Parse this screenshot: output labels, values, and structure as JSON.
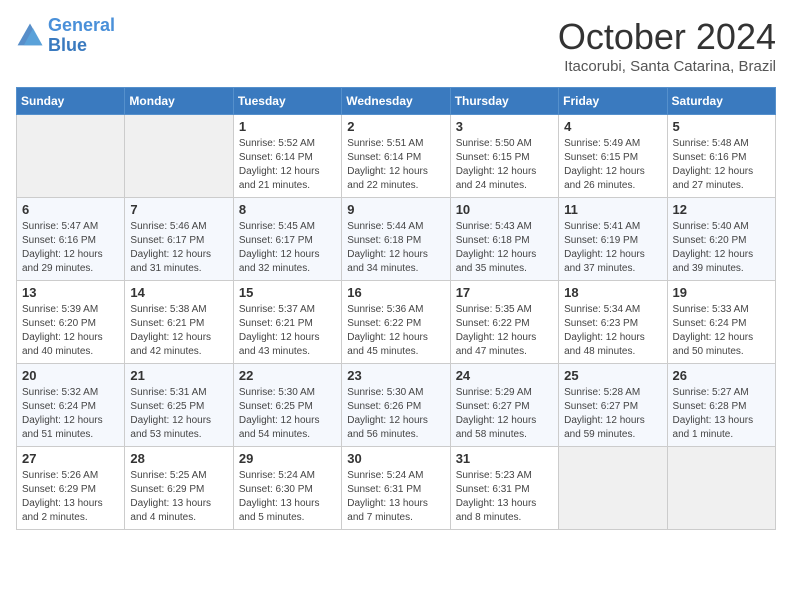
{
  "logo": {
    "line1": "General",
    "line2": "Blue"
  },
  "title": "October 2024",
  "location": "Itacorubi, Santa Catarina, Brazil",
  "weekdays": [
    "Sunday",
    "Monday",
    "Tuesday",
    "Wednesday",
    "Thursday",
    "Friday",
    "Saturday"
  ],
  "weeks": [
    [
      {
        "day": "",
        "sunrise": "",
        "sunset": "",
        "daylight": ""
      },
      {
        "day": "",
        "sunrise": "",
        "sunset": "",
        "daylight": ""
      },
      {
        "day": "1",
        "sunrise": "Sunrise: 5:52 AM",
        "sunset": "Sunset: 6:14 PM",
        "daylight": "Daylight: 12 hours and 21 minutes."
      },
      {
        "day": "2",
        "sunrise": "Sunrise: 5:51 AM",
        "sunset": "Sunset: 6:14 PM",
        "daylight": "Daylight: 12 hours and 22 minutes."
      },
      {
        "day": "3",
        "sunrise": "Sunrise: 5:50 AM",
        "sunset": "Sunset: 6:15 PM",
        "daylight": "Daylight: 12 hours and 24 minutes."
      },
      {
        "day": "4",
        "sunrise": "Sunrise: 5:49 AM",
        "sunset": "Sunset: 6:15 PM",
        "daylight": "Daylight: 12 hours and 26 minutes."
      },
      {
        "day": "5",
        "sunrise": "Sunrise: 5:48 AM",
        "sunset": "Sunset: 6:16 PM",
        "daylight": "Daylight: 12 hours and 27 minutes."
      }
    ],
    [
      {
        "day": "6",
        "sunrise": "Sunrise: 5:47 AM",
        "sunset": "Sunset: 6:16 PM",
        "daylight": "Daylight: 12 hours and 29 minutes."
      },
      {
        "day": "7",
        "sunrise": "Sunrise: 5:46 AM",
        "sunset": "Sunset: 6:17 PM",
        "daylight": "Daylight: 12 hours and 31 minutes."
      },
      {
        "day": "8",
        "sunrise": "Sunrise: 5:45 AM",
        "sunset": "Sunset: 6:17 PM",
        "daylight": "Daylight: 12 hours and 32 minutes."
      },
      {
        "day": "9",
        "sunrise": "Sunrise: 5:44 AM",
        "sunset": "Sunset: 6:18 PM",
        "daylight": "Daylight: 12 hours and 34 minutes."
      },
      {
        "day": "10",
        "sunrise": "Sunrise: 5:43 AM",
        "sunset": "Sunset: 6:18 PM",
        "daylight": "Daylight: 12 hours and 35 minutes."
      },
      {
        "day": "11",
        "sunrise": "Sunrise: 5:41 AM",
        "sunset": "Sunset: 6:19 PM",
        "daylight": "Daylight: 12 hours and 37 minutes."
      },
      {
        "day": "12",
        "sunrise": "Sunrise: 5:40 AM",
        "sunset": "Sunset: 6:20 PM",
        "daylight": "Daylight: 12 hours and 39 minutes."
      }
    ],
    [
      {
        "day": "13",
        "sunrise": "Sunrise: 5:39 AM",
        "sunset": "Sunset: 6:20 PM",
        "daylight": "Daylight: 12 hours and 40 minutes."
      },
      {
        "day": "14",
        "sunrise": "Sunrise: 5:38 AM",
        "sunset": "Sunset: 6:21 PM",
        "daylight": "Daylight: 12 hours and 42 minutes."
      },
      {
        "day": "15",
        "sunrise": "Sunrise: 5:37 AM",
        "sunset": "Sunset: 6:21 PM",
        "daylight": "Daylight: 12 hours and 43 minutes."
      },
      {
        "day": "16",
        "sunrise": "Sunrise: 5:36 AM",
        "sunset": "Sunset: 6:22 PM",
        "daylight": "Daylight: 12 hours and 45 minutes."
      },
      {
        "day": "17",
        "sunrise": "Sunrise: 5:35 AM",
        "sunset": "Sunset: 6:22 PM",
        "daylight": "Daylight: 12 hours and 47 minutes."
      },
      {
        "day": "18",
        "sunrise": "Sunrise: 5:34 AM",
        "sunset": "Sunset: 6:23 PM",
        "daylight": "Daylight: 12 hours and 48 minutes."
      },
      {
        "day": "19",
        "sunrise": "Sunrise: 5:33 AM",
        "sunset": "Sunset: 6:24 PM",
        "daylight": "Daylight: 12 hours and 50 minutes."
      }
    ],
    [
      {
        "day": "20",
        "sunrise": "Sunrise: 5:32 AM",
        "sunset": "Sunset: 6:24 PM",
        "daylight": "Daylight: 12 hours and 51 minutes."
      },
      {
        "day": "21",
        "sunrise": "Sunrise: 5:31 AM",
        "sunset": "Sunset: 6:25 PM",
        "daylight": "Daylight: 12 hours and 53 minutes."
      },
      {
        "day": "22",
        "sunrise": "Sunrise: 5:30 AM",
        "sunset": "Sunset: 6:25 PM",
        "daylight": "Daylight: 12 hours and 54 minutes."
      },
      {
        "day": "23",
        "sunrise": "Sunrise: 5:30 AM",
        "sunset": "Sunset: 6:26 PM",
        "daylight": "Daylight: 12 hours and 56 minutes."
      },
      {
        "day": "24",
        "sunrise": "Sunrise: 5:29 AM",
        "sunset": "Sunset: 6:27 PM",
        "daylight": "Daylight: 12 hours and 58 minutes."
      },
      {
        "day": "25",
        "sunrise": "Sunrise: 5:28 AM",
        "sunset": "Sunset: 6:27 PM",
        "daylight": "Daylight: 12 hours and 59 minutes."
      },
      {
        "day": "26",
        "sunrise": "Sunrise: 5:27 AM",
        "sunset": "Sunset: 6:28 PM",
        "daylight": "Daylight: 13 hours and 1 minute."
      }
    ],
    [
      {
        "day": "27",
        "sunrise": "Sunrise: 5:26 AM",
        "sunset": "Sunset: 6:29 PM",
        "daylight": "Daylight: 13 hours and 2 minutes."
      },
      {
        "day": "28",
        "sunrise": "Sunrise: 5:25 AM",
        "sunset": "Sunset: 6:29 PM",
        "daylight": "Daylight: 13 hours and 4 minutes."
      },
      {
        "day": "29",
        "sunrise": "Sunrise: 5:24 AM",
        "sunset": "Sunset: 6:30 PM",
        "daylight": "Daylight: 13 hours and 5 minutes."
      },
      {
        "day": "30",
        "sunrise": "Sunrise: 5:24 AM",
        "sunset": "Sunset: 6:31 PM",
        "daylight": "Daylight: 13 hours and 7 minutes."
      },
      {
        "day": "31",
        "sunrise": "Sunrise: 5:23 AM",
        "sunset": "Sunset: 6:31 PM",
        "daylight": "Daylight: 13 hours and 8 minutes."
      },
      {
        "day": "",
        "sunrise": "",
        "sunset": "",
        "daylight": ""
      },
      {
        "day": "",
        "sunrise": "",
        "sunset": "",
        "daylight": ""
      }
    ]
  ]
}
